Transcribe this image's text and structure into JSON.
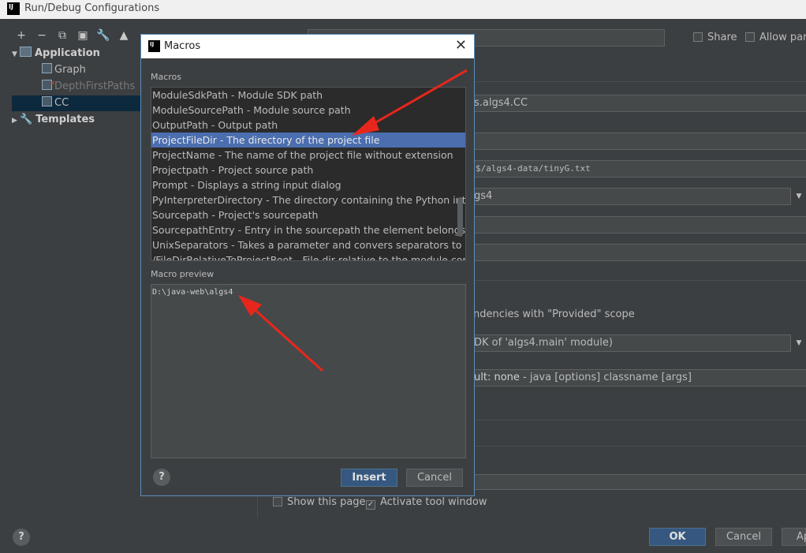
{
  "window": {
    "title": "Run/Debug Configurations"
  },
  "toolbar_icons": [
    "plus-icon",
    "minus-icon",
    "copy-icon",
    "save-icon",
    "wrench-icon",
    "arrow-up-icon",
    "arrow-down-icon"
  ],
  "header": {
    "share_label": "Share",
    "allow_parallel_label": "Allow para"
  },
  "tree": {
    "application_label": "Application",
    "items": [
      {
        "label": "Graph",
        "state": "normal"
      },
      {
        "label": "DepthFirstPaths",
        "state": "error"
      },
      {
        "label": "CC",
        "state": "selected"
      }
    ],
    "templates_label": "Templates"
  },
  "form": {
    "main_class_tail": "s.algs4.CC",
    "program_args_tail": "$/algs4-data/tinyG.txt",
    "module_tail": "gs4",
    "provided_scope_text": "ndencies with \"Provided\" scope",
    "jre_tail": "DK of 'algs4.main' module)",
    "shorten_text_bold": "ult: none",
    "shorten_text_rest": " - java [options] classname [args]",
    "show_this_page_label": "Show this page",
    "activate_tool_window_label": "Activate tool window",
    "activate_checked": true,
    "show_page_checked": false
  },
  "footer": {
    "ok_label": "OK",
    "cancel_label": "Cancel",
    "apply_label": "Ap"
  },
  "dialog": {
    "title": "Macros",
    "macros_label": "Macros",
    "macros": [
      "ModuleSdkPath - Module SDK path",
      "ModuleSourcePath - Module source path",
      "OutputPath - Output path",
      "ProjectFileDir - The directory of the project file",
      "ProjectName - The name of the project file without extension",
      "Projectpath - Project source path",
      "Prompt - Displays a string input dialog",
      "PyInterpreterDirectory - The directory containing the Python interpreter",
      "Sourcepath - Project's sourcepath",
      "SourcepathEntry - Entry in the sourcepath the element belongs to",
      "UnixSeparators - Takes a parameter and convers separators to '/'. E",
      "/FileDirRelativeToProjectRoot - File dir relative to the module content"
    ],
    "selected_index": 3,
    "preview_label": "Macro preview",
    "preview_value": "D:\\java-web\\algs4",
    "insert_label": "Insert",
    "cancel_label": "Cancel"
  },
  "colors": {
    "selection": "#4b6eaf",
    "arrow": "#e8261c",
    "primary_button": "#365880"
  }
}
